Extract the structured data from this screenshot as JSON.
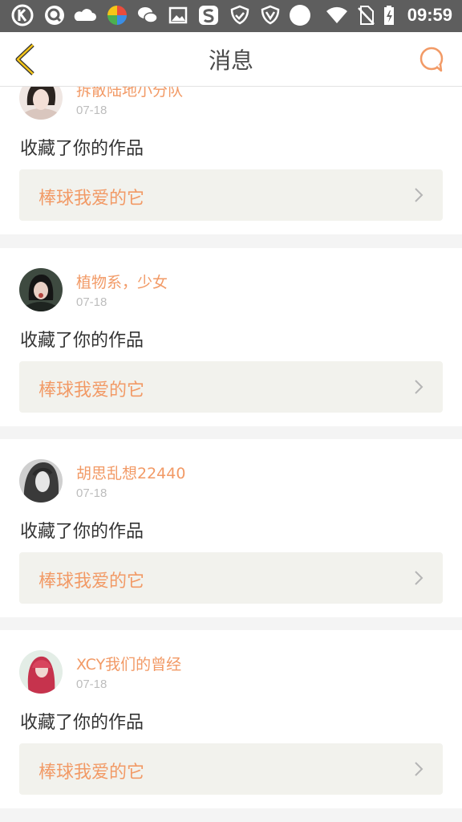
{
  "status_bar": {
    "time": "09:59",
    "icons": [
      "k-app-icon",
      "q-app-icon",
      "cloud-icon",
      "pinwheel-app-icon",
      "wechat-icon",
      "image-icon",
      "s-app-icon",
      "shield-check-icon",
      "shield-v-icon",
      "circle-icon",
      "wifi-icon",
      "no-sim-icon",
      "battery-icon"
    ]
  },
  "header": {
    "title": "消息",
    "back_icon": "chevron-left-icon",
    "action_icon": "chat-bubble-icon",
    "accent": "#f29a66"
  },
  "messages": [
    {
      "user": "拆散陆地小分队",
      "date": "07-18",
      "action": "收藏了你的作品",
      "work_title": "棒球我爱的它"
    },
    {
      "user": "植物系，少女",
      "date": "07-18",
      "action": "收藏了你的作品",
      "work_title": "棒球我爱的它"
    },
    {
      "user": "胡思乱想22440",
      "date": "07-18",
      "action": "收藏了你的作品",
      "work_title": "棒球我爱的它"
    },
    {
      "user": "XCY我们的曾经",
      "date": "07-18",
      "action": "收藏了你的作品",
      "work_title": "棒球我爱的它"
    }
  ]
}
